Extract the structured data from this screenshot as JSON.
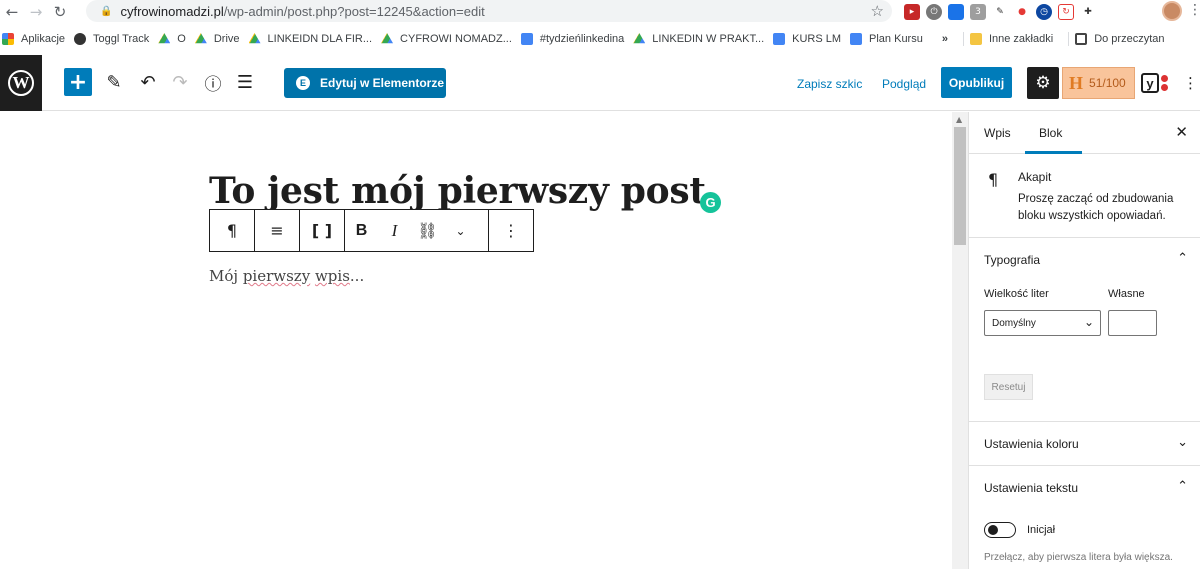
{
  "browser": {
    "url_host": "cyfrowinomadzi.pl",
    "url_path": "/wp-admin/post.php?post=12245&action=edit",
    "bookmarks": [
      {
        "label": "Aplikacje",
        "icon": "apps-grid-icon"
      },
      {
        "label": "Toggl Track",
        "icon": "toggl-icon"
      },
      {
        "label": "O",
        "icon": "drive-icon"
      },
      {
        "label": "Drive",
        "icon": "drive-icon"
      },
      {
        "label": "LINKEIDN DLA FIR...",
        "icon": "drive-icon"
      },
      {
        "label": "CYFROWI NOMADZ...",
        "icon": "drive-icon"
      },
      {
        "label": "#tydzieńlinkedina",
        "icon": "docs-icon"
      },
      {
        "label": "LINKEDIN W PRAKT...",
        "icon": "drive-icon"
      },
      {
        "label": "KURS LM",
        "icon": "docs-icon"
      },
      {
        "label": "Plan Kursu",
        "icon": "docs-icon"
      }
    ],
    "more_bookmarks": "»",
    "other_bookmarks": "Inne zakładki",
    "reading_list": "Do przeczytan"
  },
  "toolbar": {
    "elementor_label": "Edytuj w Elementorze",
    "save_draft_label": "Zapisz szkic",
    "preview_label": "Podgląd",
    "publish_label": "Opublikuj",
    "score_label": "51/100",
    "score_letter": "H"
  },
  "editor": {
    "title": "To jest mój pierwszy post",
    "paragraph_start": "Mój ",
    "paragraph_word1": "pierwszy",
    "paragraph_space": " ",
    "paragraph_word2": "wpis",
    "paragraph_end": "..."
  },
  "sidebar": {
    "tab_post": "Wpis",
    "tab_block": "Blok",
    "block_name": "Akapit",
    "block_description": "Proszę zacząć od zbudowania bloku wszystkich opowiadań.",
    "typography_title": "Typografia",
    "font_size_label": "Wielkość liter",
    "custom_label": "Własne",
    "font_size_value": "Domyślny",
    "reset_label": "Resetuj",
    "color_settings_title": "Ustawienia koloru",
    "text_settings_title": "Ustawienia tekstu",
    "dropcap_label": "Inicjał",
    "dropcap_help": "Przełącz, aby pierwsza litera była większa."
  }
}
